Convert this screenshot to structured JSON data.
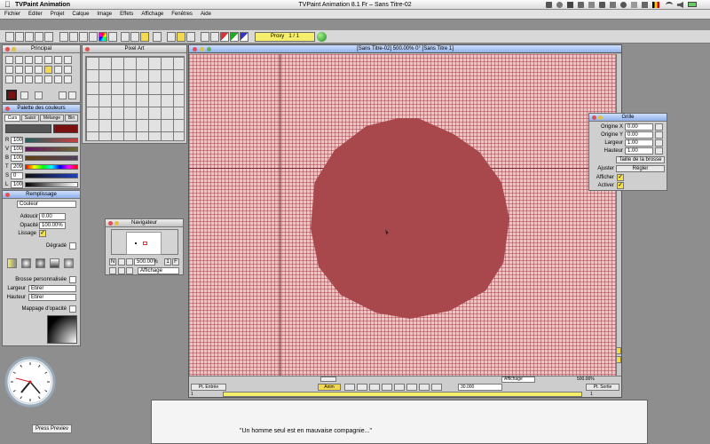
{
  "app": {
    "name": "TVPaint Animation",
    "window_title": "TVPaint Animation 8.1 Fr – Sans Titre-02"
  },
  "menu": [
    "Fichier",
    "Editer",
    "Projet",
    "Calque",
    "Image",
    "Effets",
    "Affichage",
    "Fenêtres",
    "Aide"
  ],
  "toolbar": {
    "proxy_label": "Proxy",
    "proxy_value": "1 / 1"
  },
  "canvas": {
    "header": "[Sans Titre-02]  500.00%  0°  [Sans Titre 1]",
    "bg_color": "#f2c4c4",
    "shape_color": "#a8484c"
  },
  "principal": {
    "title": "Principal"
  },
  "pixel_art": {
    "title": "Pixel Art"
  },
  "palette": {
    "title": "Palette des couleurs",
    "tabs": [
      "Curs",
      "Saisir",
      "Mélange",
      "Bin"
    ],
    "main_color": "#7a1010",
    "sliders": [
      {
        "label": "R",
        "value": "100"
      },
      {
        "label": "V",
        "value": "100"
      },
      {
        "label": "B",
        "value": "100"
      },
      {
        "label": "T",
        "value": "209"
      },
      {
        "label": "S",
        "value": "0"
      },
      {
        "label": "L",
        "value": "100"
      }
    ]
  },
  "remplissage": {
    "title": "Remplissage",
    "mode": "Couleur",
    "adoucir_label": "Adoucir",
    "adoucir_value": "0.00",
    "opacite_label": "Opacité",
    "opacite_value": "100.00%",
    "lissage_label": "Lissage",
    "degrade_label": "Dégradé",
    "brosse_label": "Brosse personnalisée",
    "largeur_label": "Largeur",
    "largeur_value": "Etirer",
    "hauteur_label": "Hauteur",
    "hauteur_value": "Etirer",
    "mappage_label": "Mappage d'opacité"
  },
  "navigateur": {
    "title": "Navigateur",
    "zoom": "500.00%",
    "view": "Affichage",
    "n": "N",
    "f": "F",
    "one": "1"
  },
  "grille": {
    "title": "Grille",
    "rows": [
      {
        "label": "Origine X",
        "value": "0.00"
      },
      {
        "label": "Origine Y",
        "value": "0.00"
      },
      {
        "label": "Largeur",
        "value": "1.00"
      },
      {
        "label": "Hauteur",
        "value": "1.00"
      }
    ],
    "taille_btn": "Taille de la brosse",
    "ajuster_label": "Ajuster",
    "regler_btn": "Régler",
    "afficher_label": "Afficher",
    "activer_label": "Activer"
  },
  "timeline": {
    "entree": "Pt. Entrée",
    "sortie": "Pt. Sortie",
    "anim": "Anim",
    "fps": "30.000",
    "view": "Affichage",
    "zoom": "500.00%",
    "frame_left": "1",
    "frame_right": "1"
  },
  "footer": {
    "quote": "\"Un homme seul est en mauvaise compagnie...\"",
    "press_preview": "Press Previev"
  }
}
